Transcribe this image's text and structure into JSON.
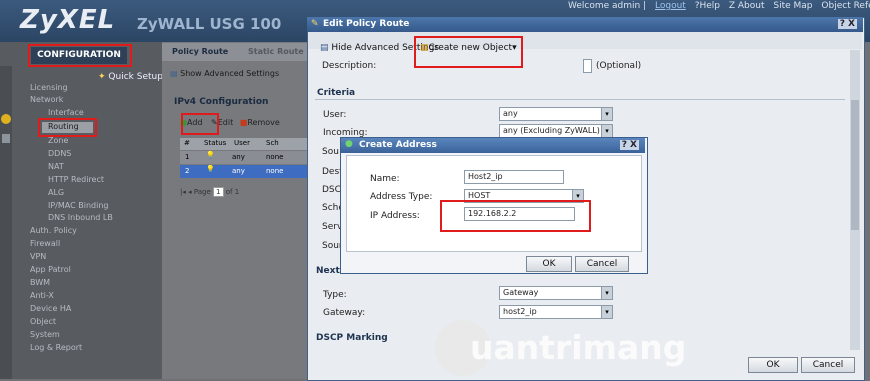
{
  "header": {
    "brand": "ZyXEL",
    "product": "ZyWALL USG 100",
    "welcome": "Welcome admin |",
    "logout": "Logout",
    "help": "?Help",
    "about": "Z About",
    "sitemap": "Site Map",
    "object_ref": "Object Refer"
  },
  "leftnav": {
    "configuration": "CONFIGURATION",
    "quick_setup": "Quick Setup",
    "items": [
      "Licensing",
      "Network",
      "Interface",
      "Routing",
      "Zone",
      "DDNS",
      "NAT",
      "HTTP Redirect",
      "ALG",
      "IP/MAC Binding",
      "DNS Inbound LB",
      "Auth. Policy",
      "Firewall",
      "VPN",
      "App Patrol",
      "BWM",
      "Anti-X",
      "Device HA",
      "Object",
      "System",
      "Log & Report"
    ]
  },
  "mid": {
    "tab_policy": "Policy Route",
    "tab_static": "Static Route",
    "show_adv": "Show Advanced Settings",
    "ipv4_title": "IPv4 Configuration",
    "add": "Add",
    "edit": "Edit",
    "remove": "Remove",
    "headers": [
      "#",
      "Status",
      "User",
      "Sch"
    ],
    "rows": [
      {
        "num": "1",
        "user": "any",
        "sch": "none"
      },
      {
        "num": "2",
        "user": "any",
        "sch": "none"
      }
    ],
    "pager_page": "Page",
    "pager_value": "1",
    "pager_of": "of 1"
  },
  "edit": {
    "title": "Edit Policy Route",
    "help_close": "? X",
    "hide_adv": "Hide Advanced Settings",
    "create_obj": "Create new Object",
    "description_label": "Description:",
    "optional": "(Optional)",
    "criteria": "Criteria",
    "user_label": "User:",
    "user_value": "any",
    "incoming_label": "Incoming:",
    "incoming_value": "any (Excluding ZyWALL)",
    "partial_labels": [
      "Sou",
      "Desti",
      "DSCP",
      "Sche",
      "Servi",
      "Sour"
    ],
    "nexthop": "Next-H",
    "type_label": "Type:",
    "type_value": "Gateway",
    "gateway_label": "Gateway:",
    "gateway_value": "host2_ip",
    "dscp_marking": "DSCP Marking",
    "ok": "OK",
    "cancel": "Cancel"
  },
  "create_address": {
    "title": "Create Address",
    "help_close": "? X",
    "name_label": "Name:",
    "name_value": "Host2_ip",
    "type_label": "Address Type:",
    "type_value": "HOST",
    "ip_label": "IP Address:",
    "ip_value": "192.168.2.2",
    "ok": "OK",
    "cancel": "Cancel"
  },
  "watermark": "uantrimang",
  "colors": {
    "highlight": "#e01b1b",
    "title_bar": "#3a6299"
  }
}
